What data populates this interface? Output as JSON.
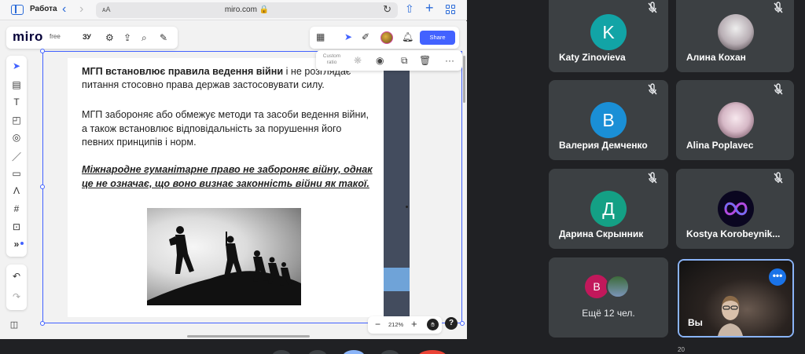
{
  "browser": {
    "tab_group": "Работа",
    "aa": "ᴀA",
    "domain": "miro.com 🔒"
  },
  "miro": {
    "logo": "miro",
    "plan": "free",
    "board_name": "ЗУ",
    "share_label": "Share",
    "context_menu_label": "Custom ratio",
    "zoom": "212%",
    "help": "?"
  },
  "slide": {
    "para1_bold": "МГП встановлює правила ведення війни",
    "para1_rest": " і не розглядає питання стосовно права держав застосовувати силу.",
    "para2": "МГП забороняє або обмежує методи та засоби ведення війни, а також встановлює відповідальність за порушення його певних принципів і норм.",
    "para3": "Міжнародне гуманітарне право не забороняє війну, однак це не означає, що воно визнає законність війни як такої."
  },
  "participants": [
    {
      "name": "Katy Zinovieva",
      "initial": "K",
      "color": "#12a4a6",
      "muted": true
    },
    {
      "name": "Алина Кохан",
      "initial": "",
      "color": "#d8d0d4",
      "muted": true
    },
    {
      "name": "Валерия Демченко",
      "initial": "В",
      "color": "#1a8fd6",
      "muted": true
    },
    {
      "name": "Alina Poplavec",
      "initial": "",
      "color": "#e8d8e0",
      "muted": true
    },
    {
      "name": "Дарина Скрынник",
      "initial": "Д",
      "color": "#14a085",
      "muted": true
    },
    {
      "name": "Kostya Korobeynik...",
      "initial": "",
      "color": "#1a0a3a",
      "muted": true
    }
  ],
  "more": {
    "initial": "В",
    "label": "Ещё 12 чел."
  },
  "self": {
    "name": "Вы",
    "more": "•••"
  },
  "badge": "20"
}
